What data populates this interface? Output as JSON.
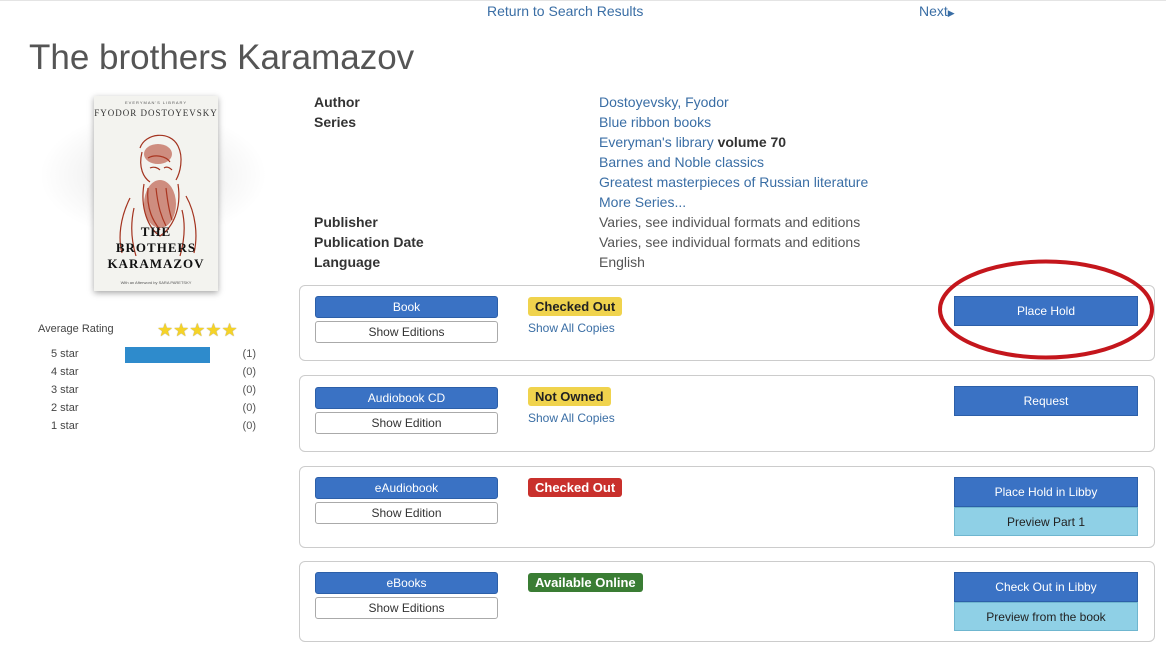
{
  "nav": {
    "return_label": "Return to Search Results",
    "next_label": "Next",
    "next_icon": "caret-right"
  },
  "title": "The brothers Karamazov",
  "cover": {
    "publisher_line": "EVERYMAN'S LIBRARY",
    "author_line": "FYODOR DOSTOYEVSKY",
    "title_line1": "THE",
    "title_line2": "BROTHERS",
    "title_line3": "KARAMAZOV",
    "footer_line": "With an Afterword by SARA PARETSKY"
  },
  "rating": {
    "label": "Average Rating",
    "stars_filled": 5,
    "stars_text": "★★★★★",
    "star_color": "#f5d327",
    "bar_color": "#2e8bcc",
    "rows": [
      {
        "label": "5 star",
        "count": "(1)",
        "fraction": 1
      },
      {
        "label": "4 star",
        "count": "(0)",
        "fraction": 0
      },
      {
        "label": "3 star",
        "count": "(0)",
        "fraction": 0
      },
      {
        "label": "2 star",
        "count": "(0)",
        "fraction": 0
      },
      {
        "label": "1 star",
        "count": "(0)",
        "fraction": 0
      }
    ]
  },
  "details": {
    "author_label": "Author",
    "author_value": "Dostoyevsky, Fyodor",
    "series_label": "Series",
    "series": [
      {
        "name": "Blue ribbon books",
        "volume": ""
      },
      {
        "name": "Everyman's library",
        "volume": "volume 70"
      },
      {
        "name": "Barnes and Noble classics",
        "volume": ""
      },
      {
        "name": "Greatest masterpieces of Russian literature",
        "volume": ""
      }
    ],
    "more_series": "More Series...",
    "publisher_label": "Publisher",
    "publisher_value": "Varies, see individual formats and editions",
    "pubdate_label": "Publication Date",
    "pubdate_value": "Varies, see individual formats and editions",
    "language_label": "Language",
    "language_value": "English"
  },
  "formats": [
    {
      "format": "Book",
      "editions": "Show Editions",
      "status": "Checked Out",
      "status_color": "#f0d34d",
      "copies": "Show All Copies",
      "action": "Place Hold",
      "preview": ""
    },
    {
      "format": "Audiobook CD",
      "editions": "Show Edition",
      "status": "Not Owned",
      "status_color": "#f0d34d",
      "copies": "Show All Copies",
      "action": "Request",
      "preview": ""
    },
    {
      "format": "eAudiobook",
      "editions": "Show Edition",
      "status": "Checked Out",
      "status_color": "#c9302c",
      "copies": "",
      "action": "Place Hold in Libby",
      "preview": "Preview Part 1"
    },
    {
      "format": "eBooks",
      "editions": "Show Editions",
      "status": "Available Online",
      "status_color": "#3a7d34",
      "copies": "",
      "action": "Check Out in Libby",
      "preview": "Preview from the book"
    }
  ],
  "colors": {
    "primary_button": "#3a72c4",
    "preview_button": "#8fd0e6",
    "link": "#3a6ea5",
    "annotation": "#c4161c"
  }
}
